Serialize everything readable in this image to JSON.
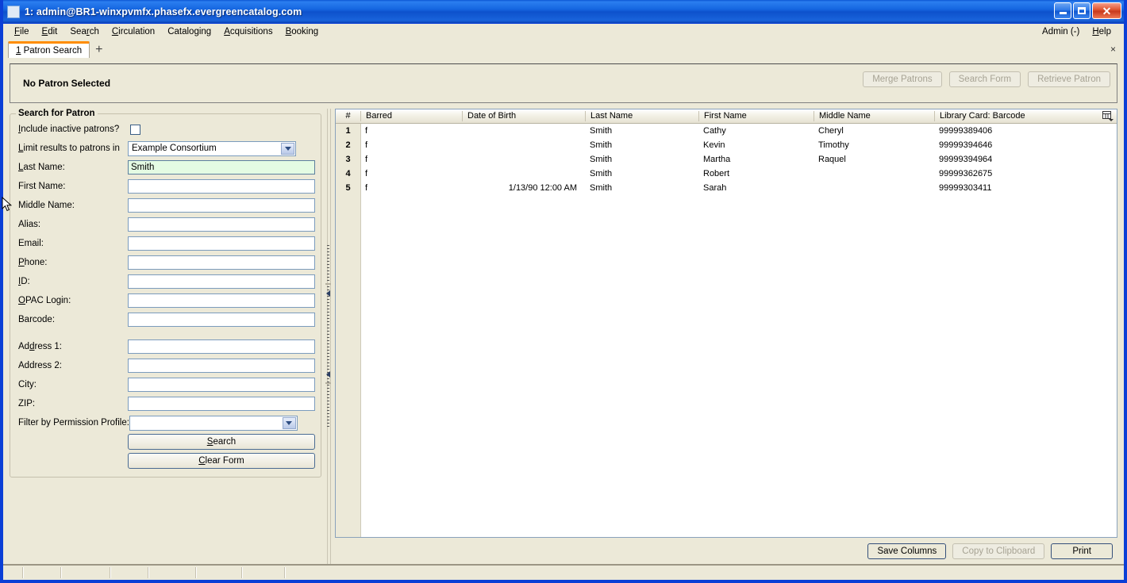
{
  "window": {
    "title": "1: admin@BR1-winxpvmfx.phasefx.evergreencatalog.com",
    "minimize_label": "",
    "maximize_label": "",
    "close_label": "✕"
  },
  "menubar": {
    "items": [
      {
        "label": "File",
        "accel": "F"
      },
      {
        "label": "Edit",
        "accel": "E"
      },
      {
        "label": "Search",
        "accel": "r"
      },
      {
        "label": "Circulation",
        "accel": "C"
      },
      {
        "label": "Cataloging",
        "accel": "g"
      },
      {
        "label": "Acquisitions",
        "accel": "A"
      },
      {
        "label": "Booking",
        "accel": "B"
      }
    ],
    "right": [
      {
        "label": "Admin (-)",
        "accel": ""
      },
      {
        "label": "Help",
        "accel": "H"
      }
    ]
  },
  "tabs": {
    "active": "1 Patron Search",
    "add_label": "+",
    "close_label": "×"
  },
  "patron_header": {
    "status": "No Patron Selected",
    "buttons": [
      {
        "label": "Merge Patrons",
        "disabled": true
      },
      {
        "label": "Search Form",
        "disabled": true
      },
      {
        "label": "Retrieve Patron",
        "disabled": true
      }
    ]
  },
  "search_form": {
    "legend": "Search for Patron",
    "include_inactive_label": "Include inactive patrons?",
    "include_inactive_checked": false,
    "limit_label": "Limit results to patrons in",
    "limit_value": "Example Consortium",
    "fields": [
      {
        "label": "Last Name:",
        "value": "Smith",
        "focused": true
      },
      {
        "label": "First Name:",
        "value": "",
        "focused": false
      },
      {
        "label": "Middle Name:",
        "value": "",
        "focused": false
      },
      {
        "label": "Alias:",
        "value": "",
        "focused": false
      },
      {
        "label": "Email:",
        "value": "",
        "focused": false
      },
      {
        "label": "Phone:",
        "value": "",
        "focused": false
      },
      {
        "label": "ID:",
        "value": "",
        "focused": false
      },
      {
        "label": "OPAC Login:",
        "value": "",
        "focused": false
      },
      {
        "label": "Barcode:",
        "value": "",
        "focused": false
      }
    ],
    "address_fields": [
      {
        "label": "Address 1:",
        "value": ""
      },
      {
        "label": "Address 2:",
        "value": ""
      },
      {
        "label": "City:",
        "value": ""
      },
      {
        "label": "ZIP:",
        "value": ""
      }
    ],
    "permission_label": "Filter by Permission Profile:",
    "permission_value": "",
    "search_button": "Search",
    "clear_button": "Clear Form"
  },
  "results": {
    "columns": [
      "#",
      "Barred",
      "Date of Birth",
      "Last Name",
      "First Name",
      "Middle Name",
      "Library Card: Barcode"
    ],
    "rows": [
      {
        "num": "1",
        "barred": "f",
        "dob": "",
        "last": "Smith",
        "first": "Cathy",
        "middle": "Cheryl",
        "barcode": "99999389406"
      },
      {
        "num": "2",
        "barred": "f",
        "dob": "",
        "last": "Smith",
        "first": "Kevin",
        "middle": "Timothy",
        "barcode": "99999394646"
      },
      {
        "num": "3",
        "barred": "f",
        "dob": "",
        "last": "Smith",
        "first": "Martha",
        "middle": "Raquel",
        "barcode": "99999394964"
      },
      {
        "num": "4",
        "barred": "f",
        "dob": "",
        "last": "Smith",
        "first": "Robert",
        "middle": "",
        "barcode": "99999362675"
      },
      {
        "num": "5",
        "barred": "f",
        "dob": "1/13/90 12:00 AM",
        "last": "Smith",
        "first": "Sarah",
        "middle": "",
        "barcode": "99999303411"
      }
    ],
    "actions": [
      {
        "label": "Save Columns",
        "disabled": false
      },
      {
        "label": "Copy to Clipboard",
        "disabled": true
      },
      {
        "label": "Print",
        "disabled": false
      }
    ]
  },
  "colors": {
    "title_blue": "#0b3fd6",
    "chrome_beige": "#ece9d8",
    "focus_green": "#e4fbe3",
    "tab_accent": "#ff8c00"
  }
}
